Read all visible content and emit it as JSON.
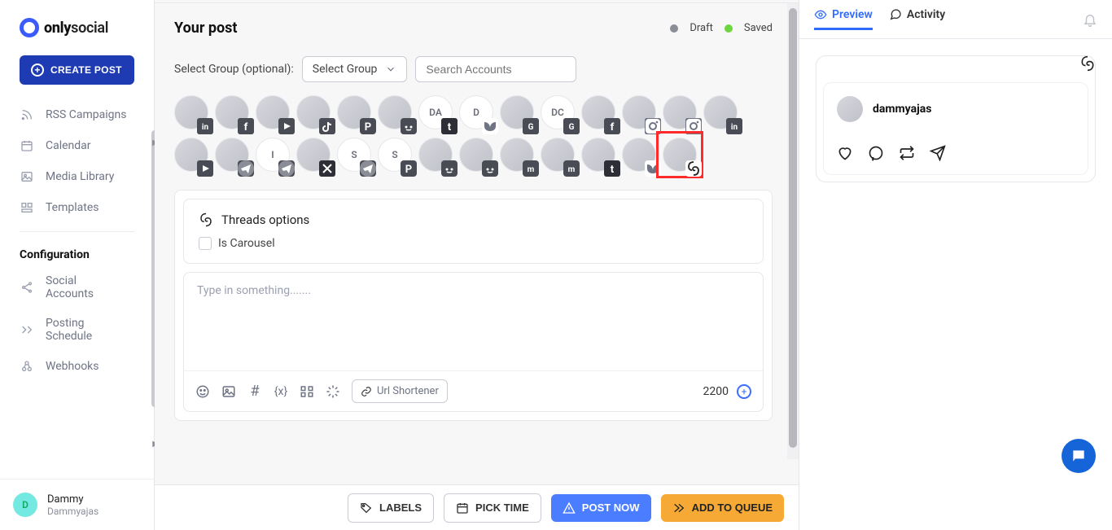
{
  "brand": {
    "name_prefix": "only",
    "name_suffix": "social"
  },
  "create_label": "CREATE POST",
  "nav": {
    "items": [
      {
        "label": "RSS Campaigns"
      },
      {
        "label": "Calendar"
      },
      {
        "label": "Media Library"
      },
      {
        "label": "Templates"
      }
    ],
    "config_title": "Configuration",
    "config_items": [
      {
        "label": "Social Accounts"
      },
      {
        "label": "Posting Schedule"
      },
      {
        "label": "Webhooks"
      }
    ]
  },
  "user": {
    "initial": "D",
    "name": "Dammy",
    "handle": "Dammyajas"
  },
  "post": {
    "title": "Your post",
    "status_draft": "Draft",
    "status_saved": "Saved",
    "group_label": "Select Group (optional):",
    "group_button": "Select Group",
    "search_placeholder": "Search Accounts",
    "threads_options": "Threads options",
    "is_carousel": "Is Carousel",
    "editor_placeholder": "Type in something.......",
    "url_shortener": "Url Shortener",
    "char_count": "2200"
  },
  "accounts_row1": [
    {
      "badge": "in"
    },
    {
      "badge": "fb"
    },
    {
      "badge": "yt"
    },
    {
      "badge": "tt"
    },
    {
      "badge": "pin"
    },
    {
      "badge": "rd"
    },
    {
      "badge": "tb",
      "letters": "DA"
    },
    {
      "badge": "bs",
      "letters": "D"
    },
    {
      "badge": "gb"
    },
    {
      "badge": "gb",
      "letters": "DC"
    },
    {
      "badge": "fb"
    },
    {
      "badge": "ig"
    },
    {
      "badge": "ig"
    },
    {
      "badge": "in"
    }
  ],
  "accounts_row2": [
    {
      "badge": "yt"
    },
    {
      "badge": "tg"
    },
    {
      "badge": "tg",
      "letters": "I"
    },
    {
      "badge": "x"
    },
    {
      "badge": "tg",
      "letters": "S"
    },
    {
      "badge": "pin",
      "letters": "S"
    },
    {
      "badge": "rd"
    },
    {
      "badge": "rd"
    },
    {
      "badge": "md"
    },
    {
      "badge": "md"
    },
    {
      "badge": "tb"
    },
    {
      "badge": "bs"
    },
    {
      "badge": "th",
      "highlight": true
    }
  ],
  "bottom": {
    "labels": "LABELS",
    "pick_time": "PICK TIME",
    "post_now": "POST NOW",
    "add_queue": "ADD TO QUEUE"
  },
  "right": {
    "tab_preview": "Preview",
    "tab_activity": "Activity",
    "username": "dammyajas"
  }
}
